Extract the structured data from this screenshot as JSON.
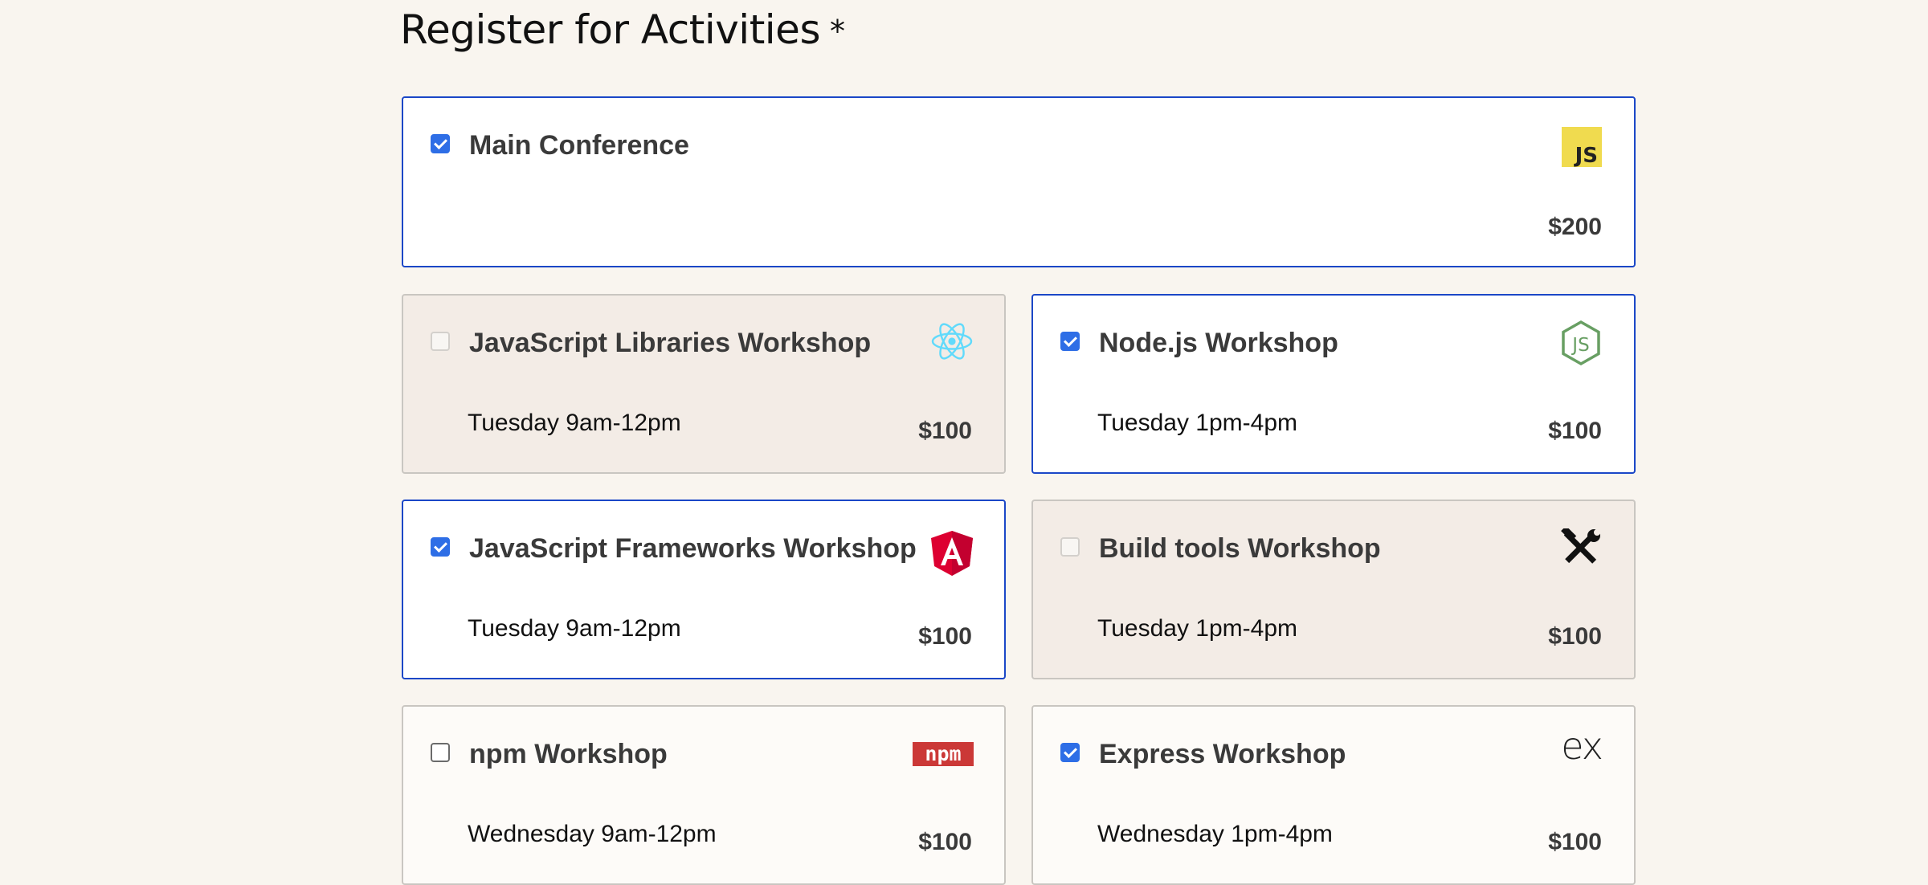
{
  "page": {
    "title": "Register for Activities",
    "required_marker": "*"
  },
  "colors": {
    "selected_border": "#1b47c7",
    "checkbox": "#2e6ee6",
    "background": "#f9f5ef"
  },
  "activities": [
    {
      "name": "Main Conference",
      "time": "",
      "price": "$200",
      "checked": true,
      "state": "selected",
      "icon": "javascript-icon",
      "icon_text": "JS"
    },
    {
      "name": "JavaScript Libraries Workshop",
      "time": "Tuesday 9am-12pm",
      "price": "$100",
      "checked": false,
      "state": "disabled",
      "icon": "react-icon"
    },
    {
      "name": "Node.js Workshop",
      "time": "Tuesday 1pm-4pm",
      "price": "$100",
      "checked": true,
      "state": "selected",
      "icon": "nodejs-icon"
    },
    {
      "name": "JavaScript Frameworks Workshop",
      "time": "Tuesday 9am-12pm",
      "price": "$100",
      "checked": true,
      "state": "selected",
      "icon": "angular-icon"
    },
    {
      "name": "Build tools Workshop",
      "time": "Tuesday 1pm-4pm",
      "price": "$100",
      "checked": false,
      "state": "disabled",
      "icon": "tools-icon"
    },
    {
      "name": "npm Workshop",
      "time": "Wednesday 9am-12pm",
      "price": "$100",
      "checked": false,
      "state": "available",
      "icon": "npm-icon",
      "icon_text": "npm"
    },
    {
      "name": "Express Workshop",
      "time": "Wednesday 1pm-4pm",
      "price": "$100",
      "checked": true,
      "state": "selected",
      "icon": "express-icon",
      "icon_text": "ex"
    }
  ]
}
